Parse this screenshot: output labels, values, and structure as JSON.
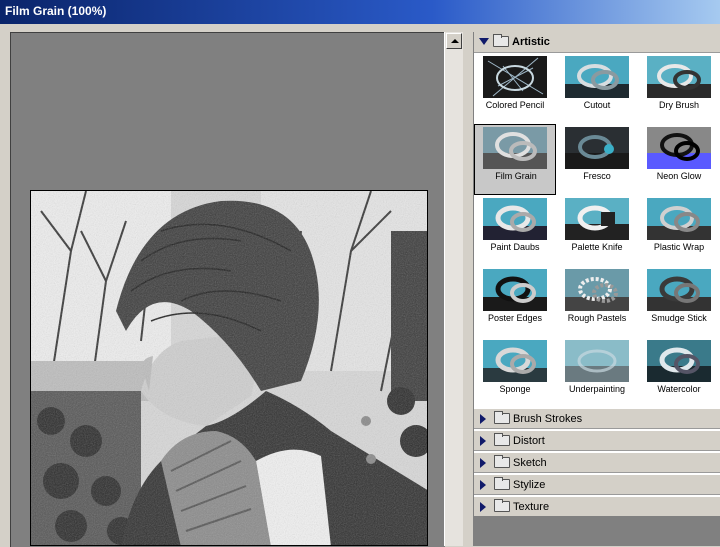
{
  "window": {
    "title": "Film Grain (100%)"
  },
  "gallery": {
    "open_category": "Artistic",
    "filters": [
      {
        "label": "Colored Pencil"
      },
      {
        "label": "Cutout"
      },
      {
        "label": "Dry Brush"
      },
      {
        "label": "Film Grain",
        "selected": true
      },
      {
        "label": "Fresco"
      },
      {
        "label": "Neon Glow"
      },
      {
        "label": "Paint Daubs"
      },
      {
        "label": "Palette Knife"
      },
      {
        "label": "Plastic Wrap"
      },
      {
        "label": "Poster Edges"
      },
      {
        "label": "Rough Pastels"
      },
      {
        "label": "Smudge Stick"
      },
      {
        "label": "Sponge"
      },
      {
        "label": "Underpainting"
      },
      {
        "label": "Watercolor"
      }
    ],
    "collapsed_categories": [
      "Brush Strokes",
      "Distort",
      "Sketch",
      "Stylize",
      "Texture"
    ]
  },
  "colors": {
    "title_start": "#0a246a",
    "title_end": "#a6caf0",
    "selection_bg": "#c8c8c8",
    "preview_bg": "#808080"
  },
  "icons": {
    "category_toggle": "triangle-down-icon",
    "collapsed_toggle": "triangle-right-icon",
    "folder": "folder-icon"
  }
}
